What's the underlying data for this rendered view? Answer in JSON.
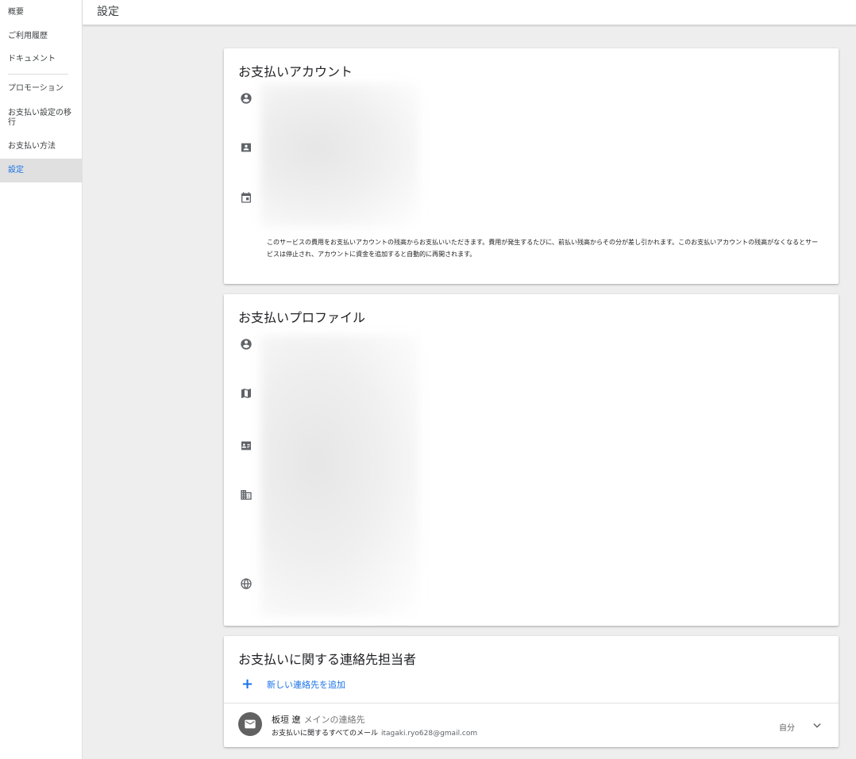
{
  "sidebar": {
    "items": [
      {
        "label": "概要"
      },
      {
        "label": "ご利用履歴"
      },
      {
        "label": "ドキュメント"
      },
      {
        "label": "プロモーション"
      },
      {
        "label": "お支払い設定の移\n行"
      },
      {
        "label": "お支払い方法"
      },
      {
        "label": "設定",
        "active": true
      }
    ]
  },
  "header": {
    "title": "設定"
  },
  "billing_account": {
    "title": "お支払いアカウント",
    "icons": [
      "account-circle-icon",
      "contact-card-icon",
      "calendar-icon"
    ],
    "description": "このサービスの費用をお支払いアカウントの残高からお支払いいただきます。費用が発生するたびに、前払い残高からその分が差し引かれます。このお支払いアカウントの残高がなくなるとサービスは停止され、アカウントに資金を追加すると自動的に再開されます。"
  },
  "payment_profile": {
    "title": "お支払いプロファイル",
    "icons": [
      "account-circle-icon",
      "map-icon",
      "id-card-icon",
      "business-icon",
      "globe-icon"
    ]
  },
  "contacts": {
    "title": "お支払いに関する連絡先担当者",
    "add_label": "新しい連絡先を追加",
    "add_icon": "plus-icon",
    "items": [
      {
        "name": "板垣 遼",
        "role": "メインの連絡先",
        "sub_label": "お支払いに関するすべてのメール",
        "email": "itagaki.ryo628@gmail.com",
        "self_label": "自分"
      }
    ]
  },
  "colors": {
    "accent": "#1a73e8",
    "active_nav_bg": "#e0e0e0",
    "page_bg": "#eeeeee",
    "icon": "#5f6368"
  }
}
